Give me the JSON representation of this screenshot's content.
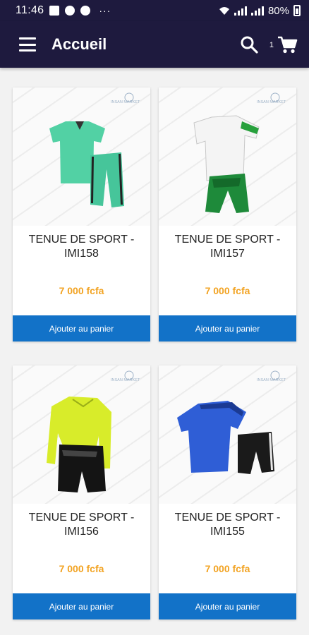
{
  "status_bar": {
    "time": "11:46",
    "dots": "···",
    "battery": "80%",
    "icons": [
      "image-icon",
      "facebook-icon",
      "facebook-icon",
      "more-icon",
      "wifi-icon",
      "signal-icon",
      "signal-icon",
      "battery-icon"
    ]
  },
  "toolbar": {
    "title": "Accueil",
    "cart_count": "1",
    "icons": [
      "menu-icon",
      "search-icon",
      "cart-icon"
    ]
  },
  "colors": {
    "toolbar": "#1e1a3e",
    "price": "#f2a322",
    "button": "#1272c8"
  },
  "products": [
    {
      "name": "TENUE DE SPORT - IMI158",
      "price": "7 000 fcfa",
      "button": "Ajouter au panier",
      "brand": "INSAN MARKET"
    },
    {
      "name": "TENUE DE SPORT - IMI157",
      "price": "7 000 fcfa",
      "button": "Ajouter au panier",
      "brand": "INSAN MARKET"
    },
    {
      "name": "TENUE DE SPORT - IMI156",
      "price": "7 000 fcfa",
      "button": "Ajouter au panier",
      "brand": "INSAN MARKET"
    },
    {
      "name": "TENUE DE SPORT - IMI155",
      "price": "7 000 fcfa",
      "button": "Ajouter au panier",
      "brand": "INSAN MARKET"
    }
  ]
}
